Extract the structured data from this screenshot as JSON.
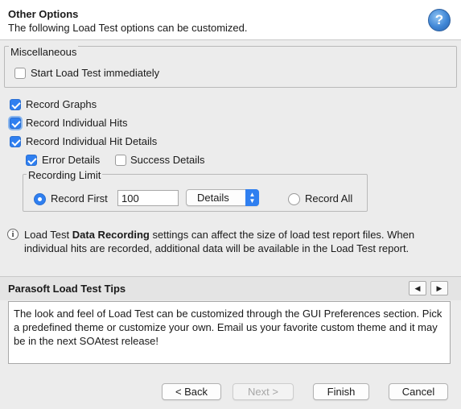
{
  "header": {
    "title": "Other Options",
    "subtitle": "The following Load Test options can be customized.",
    "help_glyph": "?"
  },
  "miscellaneous": {
    "legend": "Miscellaneous",
    "start_immediately": {
      "label": "Start Load Test immediately",
      "checked": false
    }
  },
  "recording": {
    "record_graphs": {
      "label": "Record Graphs",
      "checked": true
    },
    "record_individual_hits": {
      "label": "Record Individual Hits",
      "checked": true
    },
    "record_individual_hit_details": {
      "label": "Record Individual Hit Details",
      "checked": true
    },
    "error_details": {
      "label": "Error Details",
      "checked": true
    },
    "success_details": {
      "label": "Success Details",
      "checked": false
    }
  },
  "recording_limit": {
    "legend": "Recording Limit",
    "record_first_label": "Record First",
    "record_first_value": "100",
    "unit_select": "Details",
    "record_all_label": "Record All",
    "selected": "record_first"
  },
  "info": {
    "icon": "info-icon",
    "text_before": "Load Test ",
    "text_bold": "Data Recording",
    "text_after": " settings can affect the size of load test report files. When individual hits are recorded, additional data will be available in the Load Test report."
  },
  "tips": {
    "title": "Parasoft Load Test Tips",
    "prev": "◀",
    "next": "▶",
    "text": "The look and feel of Load Test can be customized through the GUI Preferences section. Pick a predefined theme or customize your own.  Email us your favorite custom theme and it may be in the next SOAtest release!"
  },
  "buttons": {
    "back": "< Back",
    "next": "Next >",
    "finish": "Finish",
    "cancel": "Cancel"
  },
  "colors": {
    "accent": "#2f7ff0",
    "background": "#ececec"
  }
}
